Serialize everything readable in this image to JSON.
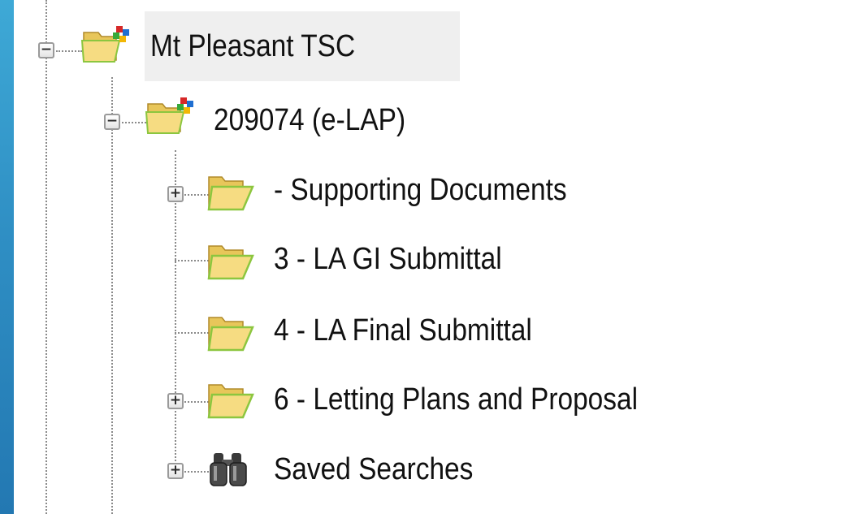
{
  "tree": {
    "root": {
      "label": "Mt Pleasant TSC",
      "expander": "−",
      "icon": "project-folder-icon",
      "selected": true
    },
    "project": {
      "label": "209074 (e-LAP)",
      "expander": "−",
      "icon": "project-folder-icon"
    },
    "folders": [
      {
        "label": "- Supporting Documents",
        "expander": "+",
        "icon": "folder-icon"
      },
      {
        "label": "3 - LA GI Submittal",
        "expander": "",
        "icon": "folder-icon"
      },
      {
        "label": "4 - LA Final Submittal",
        "expander": "",
        "icon": "folder-icon"
      },
      {
        "label": "6 - Letting Plans and Proposal",
        "expander": "+",
        "icon": "folder-icon"
      },
      {
        "label": "Saved Searches",
        "expander": "+",
        "icon": "binoculars-icon"
      }
    ]
  },
  "colors": {
    "background_blue": "#2f8fc4",
    "selection": "#efefef",
    "folder_yellow": "#f3d97a",
    "folder_green_edge": "#8cc63f"
  }
}
